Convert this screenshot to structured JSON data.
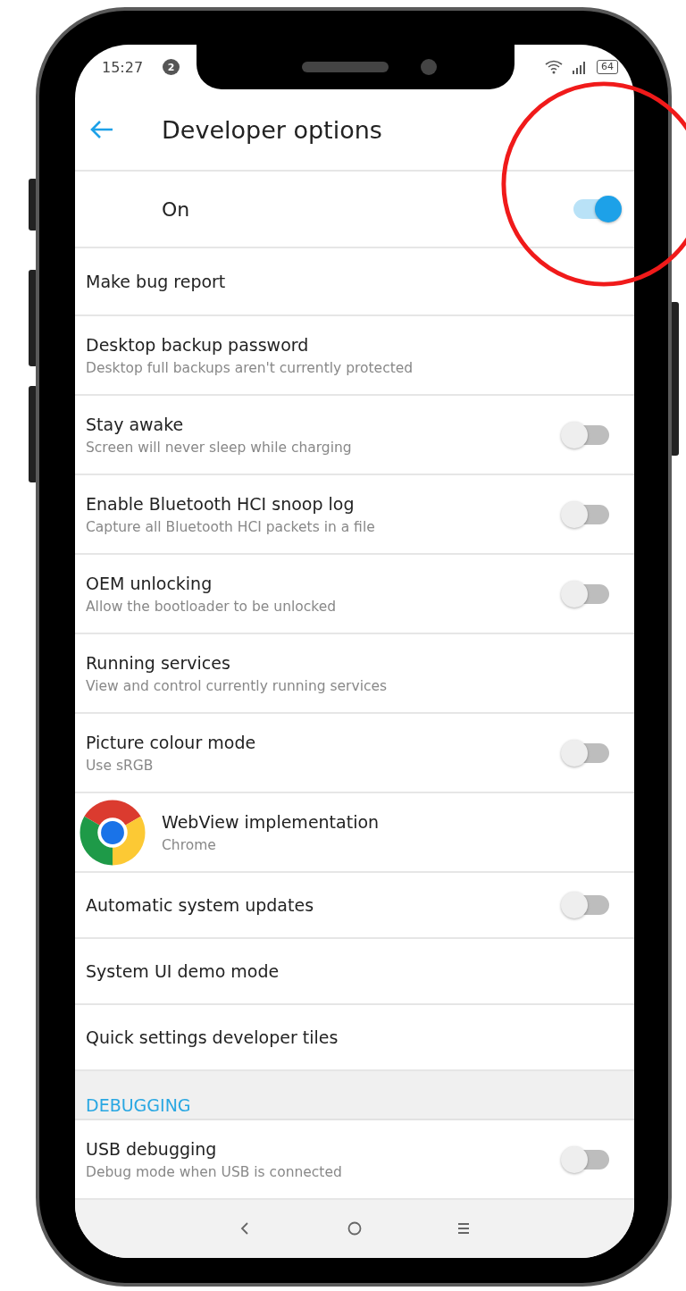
{
  "status_bar": {
    "time": "15:27",
    "notification_count": "2",
    "battery": "64"
  },
  "header": {
    "title": "Developer options"
  },
  "master": {
    "label": "On",
    "on": true
  },
  "items": [
    {
      "kind": "plain",
      "title": "Make bug report"
    },
    {
      "kind": "text",
      "title": "Desktop backup password",
      "subtitle": "Desktop full backups aren't currently protected"
    },
    {
      "kind": "toggle",
      "title": "Stay awake",
      "subtitle": "Screen will never sleep while charging",
      "on": false
    },
    {
      "kind": "toggle",
      "title": "Enable Bluetooth HCI snoop log",
      "subtitle": "Capture all Bluetooth HCI packets in a file",
      "on": false
    },
    {
      "kind": "toggle",
      "title": "OEM unlocking",
      "subtitle": "Allow the bootloader to be unlocked",
      "on": false
    },
    {
      "kind": "text",
      "title": "Running services",
      "subtitle": "View and control currently running services"
    },
    {
      "kind": "toggle",
      "title": "Picture colour mode",
      "subtitle": "Use sRGB",
      "on": false
    },
    {
      "kind": "app",
      "title": "WebView implementation",
      "subtitle": "Chrome"
    },
    {
      "kind": "toggle",
      "title": "Automatic system updates",
      "on": false
    },
    {
      "kind": "plain",
      "title": "System UI demo mode"
    },
    {
      "kind": "plain",
      "title": "Quick settings developer tiles"
    }
  ],
  "section": {
    "title": "DEBUGGING",
    "items": [
      {
        "kind": "toggle",
        "title": "USB debugging",
        "subtitle": "Debug mode when USB is connected",
        "on": false
      }
    ]
  }
}
